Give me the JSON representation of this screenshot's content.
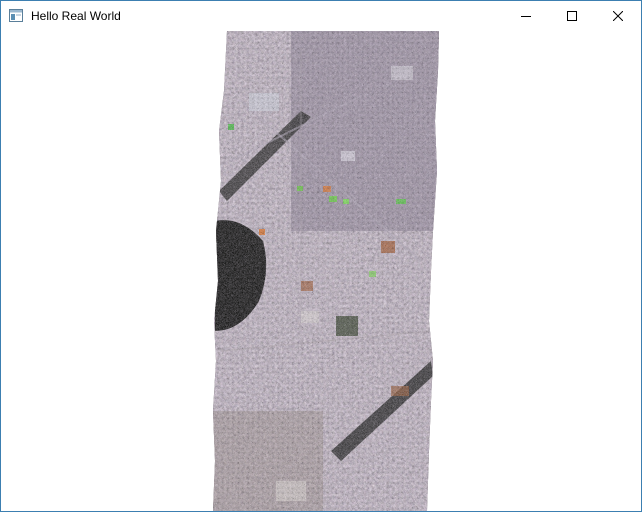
{
  "window": {
    "title": "Hello Real World",
    "icon": "window-app-icon",
    "controls": {
      "minimize_icon": "minimize-icon",
      "maximize_icon": "maximize-icon",
      "close_icon": "close-icon"
    },
    "border_color": "#3c7fb1"
  },
  "content": {
    "image_subject": "satellite-image-strip",
    "background_color": "#ffffff"
  }
}
